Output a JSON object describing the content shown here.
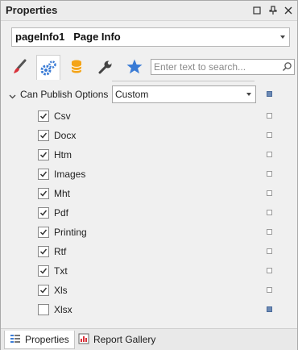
{
  "window": {
    "title": "Properties"
  },
  "titlebar_buttons": [
    "maximize-icon",
    "pin-icon",
    "close-icon"
  ],
  "object_selector": {
    "text": "pageInfo1   Page Info"
  },
  "toolbar": {
    "icons": [
      "brush-icon",
      "gears-icon",
      "database-icon",
      "wrench-icon",
      "star-icon"
    ],
    "active_icon": "gears-icon"
  },
  "search": {
    "placeholder": "Enter text to search..."
  },
  "category": {
    "label": "Can Publish Options",
    "value": "Custom"
  },
  "options": [
    {
      "label": "Csv",
      "checked": true
    },
    {
      "label": "Docx",
      "checked": true
    },
    {
      "label": "Htm",
      "checked": true
    },
    {
      "label": "Images",
      "checked": true
    },
    {
      "label": "Mht",
      "checked": true
    },
    {
      "label": "Pdf",
      "checked": true
    },
    {
      "label": "Printing",
      "checked": true
    },
    {
      "label": "Rtf",
      "checked": true
    },
    {
      "label": "Txt",
      "checked": true
    },
    {
      "label": "Xls",
      "checked": true
    },
    {
      "label": "Xlsx",
      "checked": false
    }
  ],
  "bottom_tabs": [
    {
      "label": "Properties",
      "icon": "properties-icon",
      "active": true
    },
    {
      "label": "Report Gallery",
      "icon": "report-gallery-icon",
      "active": false
    }
  ],
  "colors": {
    "accent": "#3a7bd5",
    "marker_filled": "#6c8ab5",
    "star": "#3a7bd5"
  }
}
